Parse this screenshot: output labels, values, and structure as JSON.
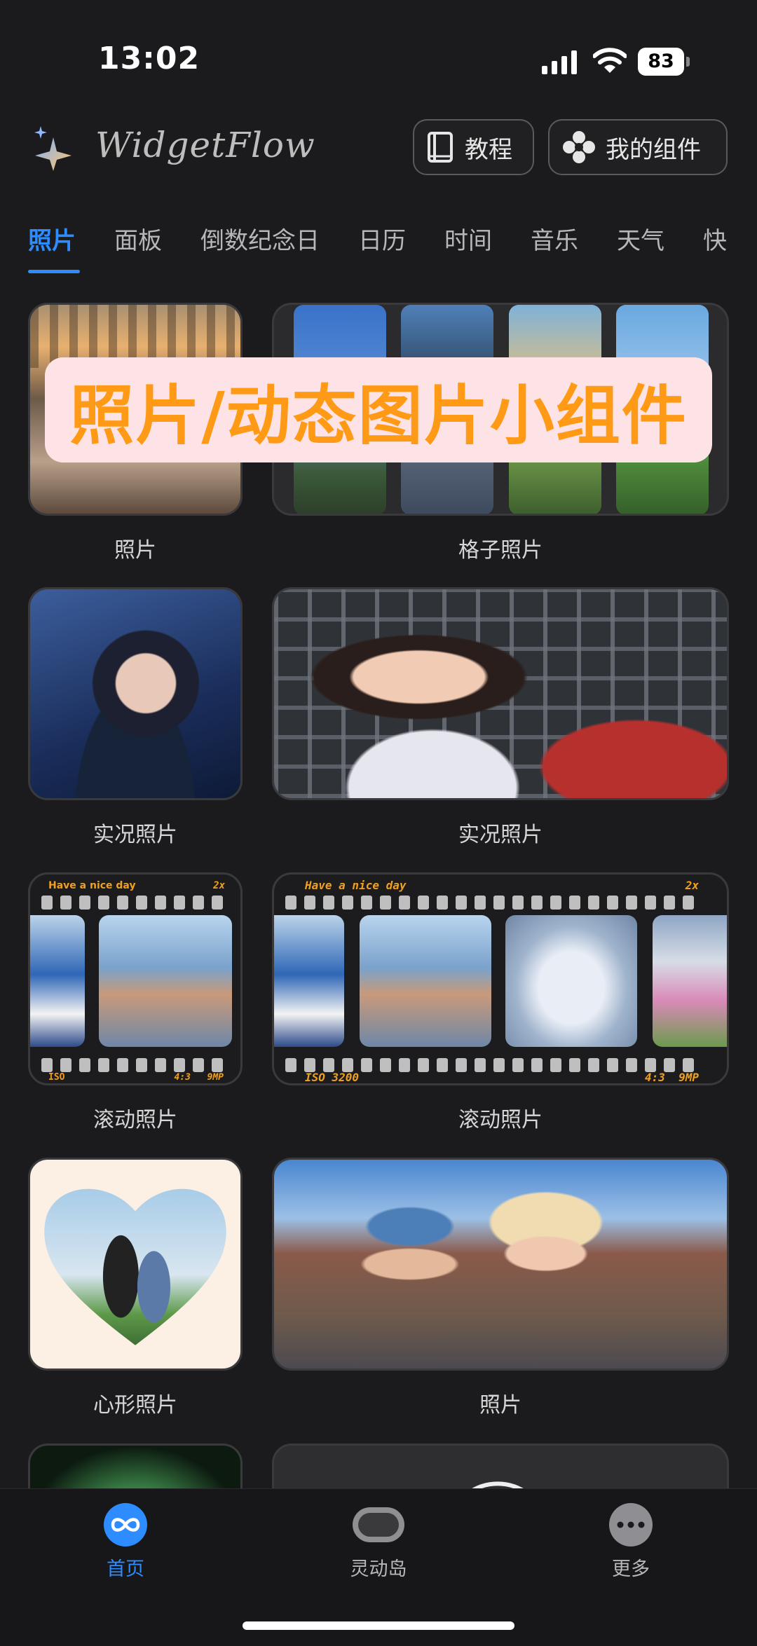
{
  "status": {
    "time": "13:02",
    "battery": "83"
  },
  "header": {
    "logo": "WidgetFlow",
    "tutorial_label": "教程",
    "my_widgets_label": "我的组件"
  },
  "tabs": [
    "照片",
    "面板",
    "倒数纪念日",
    "日历",
    "时间",
    "音乐",
    "天气",
    "快"
  ],
  "banner": "照片/动态图片小组件",
  "widgets": [
    {
      "caption": "照片"
    },
    {
      "caption": "格子照片"
    },
    {
      "caption": "实况照片"
    },
    {
      "caption": "实况照片"
    },
    {
      "caption": "滚动照片"
    },
    {
      "caption": "滚动照片"
    },
    {
      "caption": "心形照片"
    },
    {
      "caption": "照片"
    }
  ],
  "film_small": {
    "top_left": "Have a nice day",
    "top_right": "2x",
    "bottom_left": "ISO",
    "bottom_right": "4:3   9MP"
  },
  "film_large": {
    "top_left": "Have a nice day",
    "top_right": "2x",
    "bottom_left": "ISO 3200",
    "bottom_right": "4:3  9MP"
  },
  "bottom_nav": [
    {
      "label": "首页",
      "icon": "infinity-icon",
      "active": true
    },
    {
      "label": "灵动岛",
      "icon": "dynamic-island-icon",
      "active": false
    },
    {
      "label": "更多",
      "icon": "more-dots-icon",
      "active": false
    }
  ],
  "colors": {
    "accent": "#2d8cff",
    "banner_text": "#ff9a16",
    "banner_bg": "#fde3e6",
    "background": "#1b1b1d"
  }
}
